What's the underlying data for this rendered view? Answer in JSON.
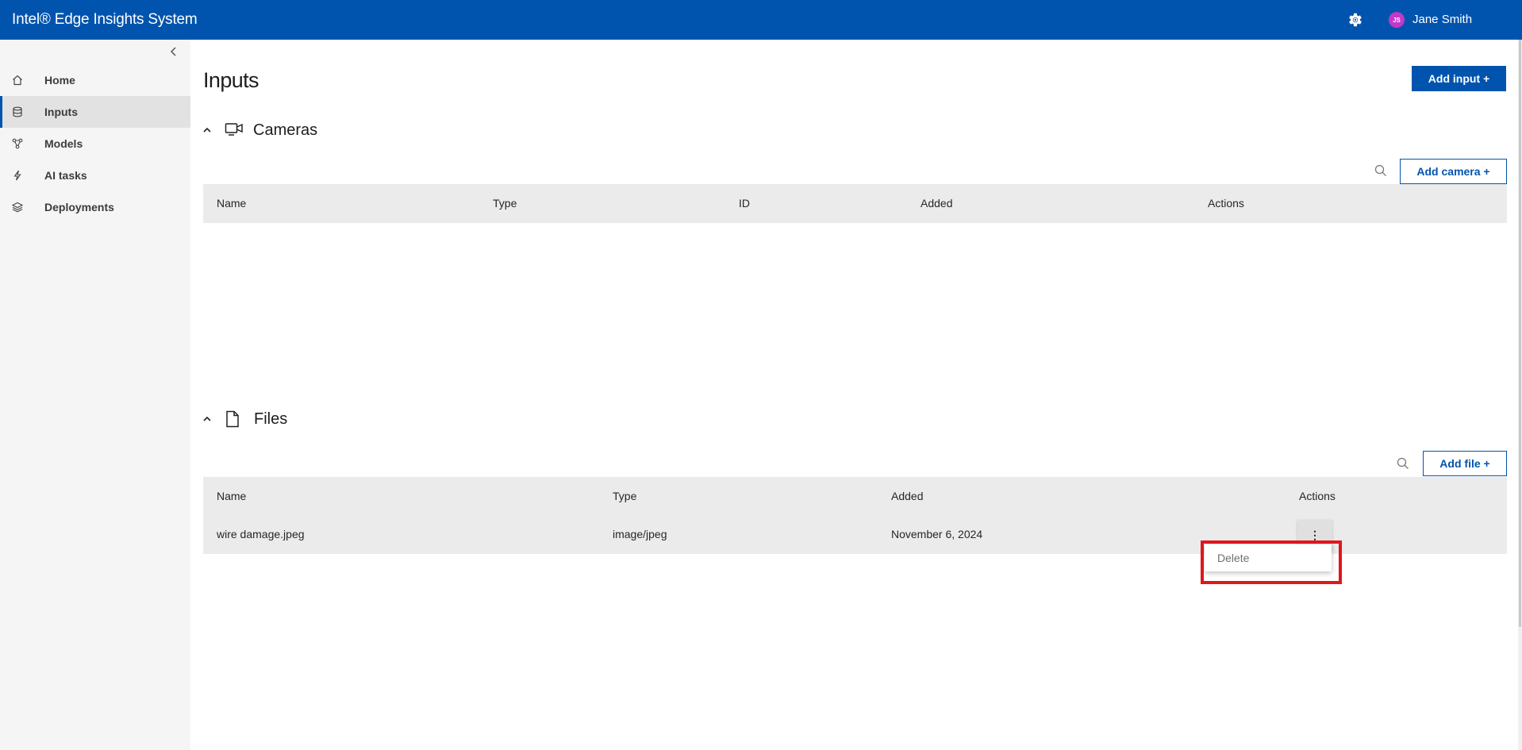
{
  "app": {
    "title": "Intel® Edge Insights System"
  },
  "user": {
    "initials": "JS",
    "name": "Jane Smith"
  },
  "sidebar": {
    "items": [
      {
        "label": "Home",
        "icon": "home-icon"
      },
      {
        "label": "Inputs",
        "icon": "database-icon",
        "active": true
      },
      {
        "label": "Models",
        "icon": "models-icon"
      },
      {
        "label": "AI tasks",
        "icon": "lightning-icon"
      },
      {
        "label": "Deployments",
        "icon": "layers-icon"
      }
    ]
  },
  "page": {
    "title": "Inputs",
    "add_input_label": "Add input +"
  },
  "cameras": {
    "title": "Cameras",
    "add_label": "Add camera +",
    "columns": [
      "Name",
      "Type",
      "ID",
      "Added",
      "Actions"
    ]
  },
  "files": {
    "title": "Files",
    "add_label": "Add file +",
    "columns": [
      "Name",
      "Type",
      "Added",
      "Actions"
    ],
    "rows": [
      {
        "name": "wire damage.jpeg",
        "type": "image/jpeg",
        "added": "November 6, 2024",
        "actions": "⋮"
      }
    ]
  },
  "context_menu": {
    "items": [
      "Delete"
    ]
  },
  "colors": {
    "brand": "#0054ae",
    "highlight": "#e0161e",
    "avatar": "#c338c9"
  }
}
